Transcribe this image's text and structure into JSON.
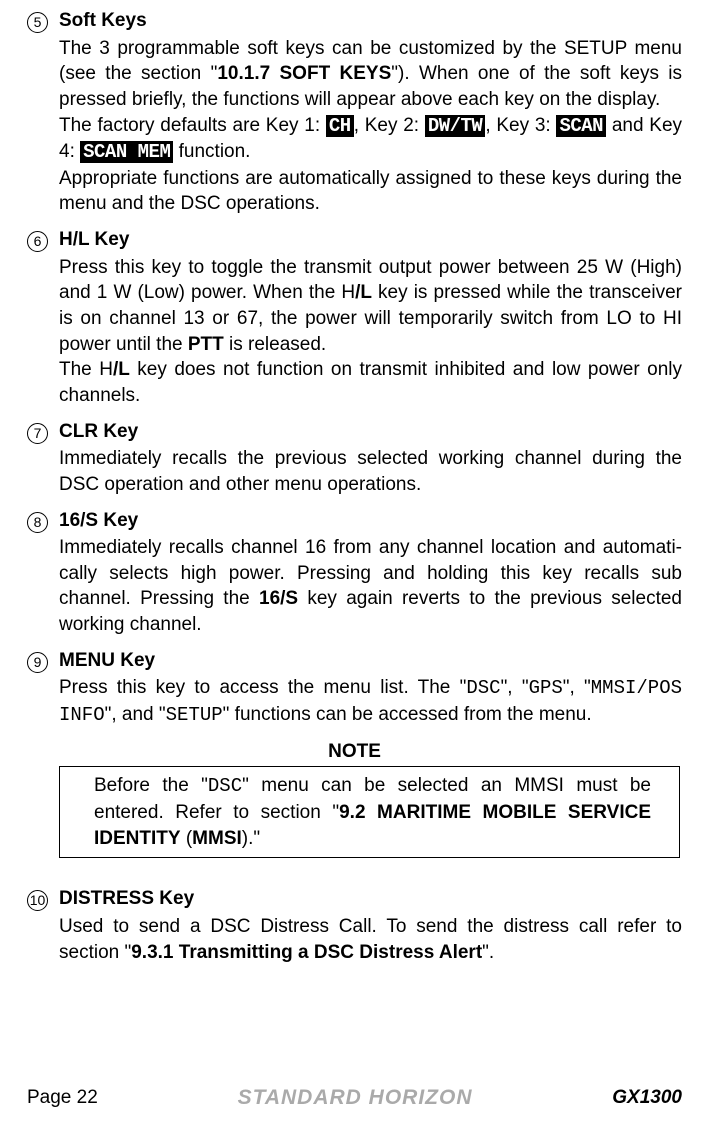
{
  "items": [
    {
      "num": "5",
      "title": "Soft Keys",
      "paras": [
        {
          "segs": [
            {
              "t": "The 3 programmable soft keys can be customized by the SETUP menu (see the section \""
            },
            {
              "t": "10.1.7 SOFT KEYS",
              "cls": "bold"
            },
            {
              "t": "\"). When one of the soft keys is pressed briefly, the functions will appear above each key on the display."
            }
          ]
        },
        {
          "segs": [
            {
              "t": "The factory defaults are Key 1: "
            },
            {
              "t": "CH",
              "cls": "inv"
            },
            {
              "t": ", Key 2: "
            },
            {
              "t": "DW/TW",
              "cls": "inv"
            },
            {
              "t": ", Key 3: "
            },
            {
              "t": "SCAN",
              "cls": "inv"
            },
            {
              "t": " and Key 4: "
            },
            {
              "t": "SCAN MEM",
              "cls": "inv"
            },
            {
              "t": " function."
            }
          ]
        },
        {
          "segs": [
            {
              "t": "Appropriate functions are automatically assigned to these keys during the menu and the DSC operations."
            }
          ]
        }
      ]
    },
    {
      "num": "6",
      "title": "H/L Key",
      "paras": [
        {
          "segs": [
            {
              "t": "Press this key to toggle the transmit output power between 25 W (High) and 1 W (Low) power. When the H"
            },
            {
              "t": "/L",
              "cls": "bold"
            },
            {
              "t": " key is pressed while the transceiver is on channel 13 or 67, the power will temporarily switch from LO to HI power until the "
            },
            {
              "t": "PTT",
              "cls": "bold"
            },
            {
              "t": " is released."
            }
          ]
        },
        {
          "segs": [
            {
              "t": "The H"
            },
            {
              "t": "/L",
              "cls": "bold"
            },
            {
              "t": " key does not function on transmit inhibited and low power only channels."
            }
          ]
        }
      ]
    },
    {
      "num": "7",
      "title": "CLR Key",
      "paras": [
        {
          "segs": [
            {
              "t": "Immediately recalls the previous selected working channel during the DSC operation and other menu operations."
            }
          ]
        }
      ]
    },
    {
      "num": "8",
      "title": "16/S Key",
      "paras": [
        {
          "segs": [
            {
              "t": "Immediately recalls channel 16 from any channel location and automati­cally selects high power. Pressing and holding this key recalls sub channel. Pressing the "
            },
            {
              "t": "16/S",
              "cls": "bold"
            },
            {
              "t": " key again reverts to the previous selected working channel."
            }
          ]
        }
      ]
    },
    {
      "num": "9",
      "title": "MENU Key",
      "paras": [
        {
          "segs": [
            {
              "t": "Press this key to access the menu list. The \""
            },
            {
              "t": "DSC",
              "cls": "mono"
            },
            {
              "t": "\", \""
            },
            {
              "t": "GPS",
              "cls": "mono"
            },
            {
              "t": "\", \""
            },
            {
              "t": "MMSI/POS INFO",
              "cls": "mono"
            },
            {
              "t": "\", and \""
            },
            {
              "t": "SETUP",
              "cls": "mono"
            },
            {
              "t": "\" functions can be accessed from the menu."
            }
          ]
        }
      ]
    }
  ],
  "note": {
    "heading": "NOTE",
    "segs": [
      {
        "t": "Before the \""
      },
      {
        "t": "DSC",
        "cls": "mono"
      },
      {
        "t": "\" menu can be selected an MMSI must be entered. Refer to section \""
      },
      {
        "t": "9.2 MARITIME MOBILE SERVICE IDENTITY",
        "cls": "bold"
      },
      {
        "t": " ("
      },
      {
        "t": "MMSI",
        "cls": "bold"
      },
      {
        "t": ").\""
      }
    ]
  },
  "distress": {
    "num": "10",
    "title": "DISTRESS Key",
    "segs": [
      {
        "t": "Used to send a DSC Distress Call. To send the distress call refer to section \""
      },
      {
        "t": "9.3.1 Transmitting a DSC Distress Alert",
        "cls": "bold"
      },
      {
        "t": "\"."
      }
    ]
  },
  "footer": {
    "page": "Page 22",
    "brand": "STANDARD HORIZON",
    "model": "GX1300"
  }
}
